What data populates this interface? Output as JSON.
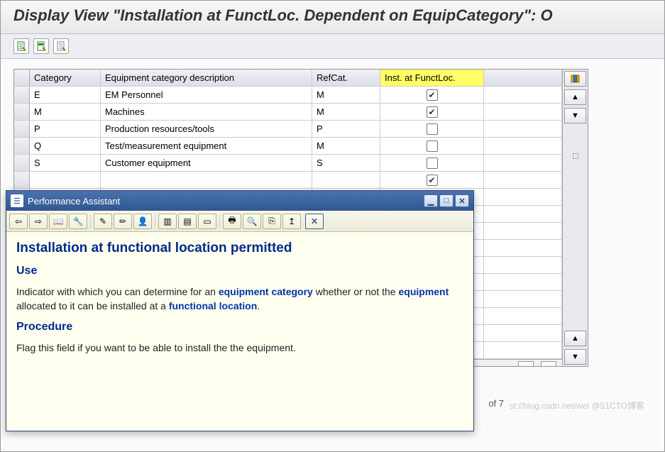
{
  "title": "Display View \"Installation at FunctLoc. Dependent on EquipCategory\": O",
  "toolbar": {
    "btn1": "details",
    "btn2": "select-block",
    "btn3": "deselect-all"
  },
  "table": {
    "headers": {
      "category": "Category",
      "description": "Equipment category description",
      "refcat": "RefCat.",
      "inst": "Inst. at FunctLoc."
    },
    "rows": [
      {
        "cat": "E",
        "desc": "EM Personnel",
        "ref": "M",
        "inst": true
      },
      {
        "cat": "M",
        "desc": "Machines",
        "ref": "M",
        "inst": true
      },
      {
        "cat": "P",
        "desc": "Production resources/tools",
        "ref": "P",
        "inst": false
      },
      {
        "cat": "Q",
        "desc": "Test/measurement equipment",
        "ref": "M",
        "inst": false
      },
      {
        "cat": "S",
        "desc": "Customer equipment",
        "ref": "S",
        "inst": false
      },
      {
        "cat": "",
        "desc": "",
        "ref": "",
        "inst": true,
        "hidden_left": true
      },
      {
        "cat": "",
        "desc": "",
        "ref": "",
        "inst": true,
        "hidden_left": true,
        "highlight_box": true
      }
    ],
    "footer": "of 7"
  },
  "popup": {
    "window_title": "Performance Assistant",
    "h1": "Installation at functional location permitted",
    "use_h": "Use",
    "use_p_pre": "Indicator with which you can determine for an ",
    "use_link1": "equipment category",
    "use_p_mid": " whether or not the ",
    "use_link2": "equipment",
    "use_p_mid2": " allocated to it can be installed at a ",
    "use_link3": "functional location",
    "use_p_end": ".",
    "proc_h": "Procedure",
    "proc_p": "Flag this field if you want to be able to install the the equipment."
  },
  "watermark": "st://blog.csdn.net/wei  @51CTO博客"
}
